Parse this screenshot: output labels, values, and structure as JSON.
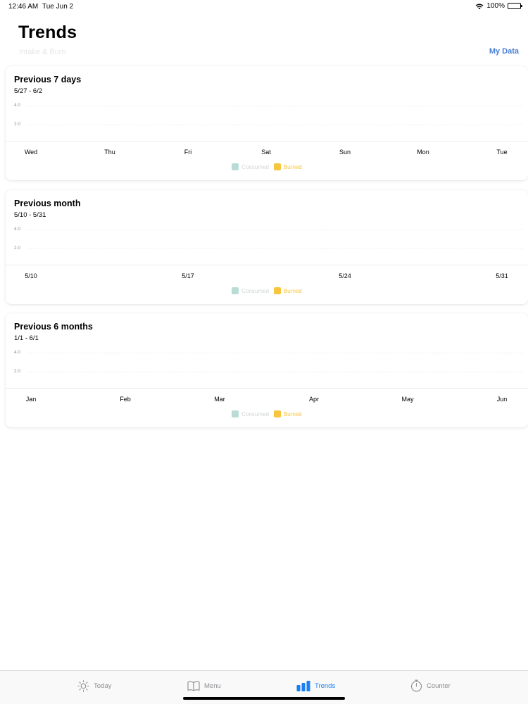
{
  "status_bar": {
    "time": "12:46 AM",
    "date": "Tue Jun 2",
    "battery": "100%"
  },
  "header": {
    "title": "Trends",
    "subtitle": "Intake & Burn",
    "my_data_link": "My Data"
  },
  "colors": {
    "accent": "#1a7ff0",
    "link": "#4a7fd4",
    "consumed": "#b9ddd6",
    "burned": "#f6c63f"
  },
  "cards": [
    {
      "title": "Previous 7 days",
      "range": "5/27 - 6/2",
      "y_ticks": [
        "4.0",
        "2.0"
      ],
      "x_ticks": [
        "Wed",
        "Thu",
        "Fri",
        "Sat",
        "Sun",
        "Mon",
        "Tue"
      ],
      "legend": {
        "consumed": "Consumed",
        "burned": "Burned"
      }
    },
    {
      "title": "Previous month",
      "range": "5/10 - 5/31",
      "y_ticks": [
        "4.0",
        "2.0"
      ],
      "x_ticks": [
        "5/10",
        "5/17",
        "5/24",
        "5/31"
      ],
      "legend": {
        "consumed": "Consumed",
        "burned": "Burned"
      }
    },
    {
      "title": "Previous 6 months",
      "range": "1/1 - 6/1",
      "y_ticks": [
        "4.0",
        "2.0"
      ],
      "x_ticks": [
        "Jan",
        "Feb",
        "Mar",
        "Apr",
        "May",
        "Jun"
      ],
      "legend": {
        "consumed": "Consumed",
        "burned": "Burned"
      }
    }
  ],
  "tab_bar": {
    "items": [
      {
        "label": "Today",
        "icon": "sun-icon"
      },
      {
        "label": "Menu",
        "icon": "book-icon"
      },
      {
        "label": "Trends",
        "icon": "bar-chart-icon"
      },
      {
        "label": "Counter",
        "icon": "stopwatch-icon"
      }
    ],
    "active": "Trends"
  }
}
